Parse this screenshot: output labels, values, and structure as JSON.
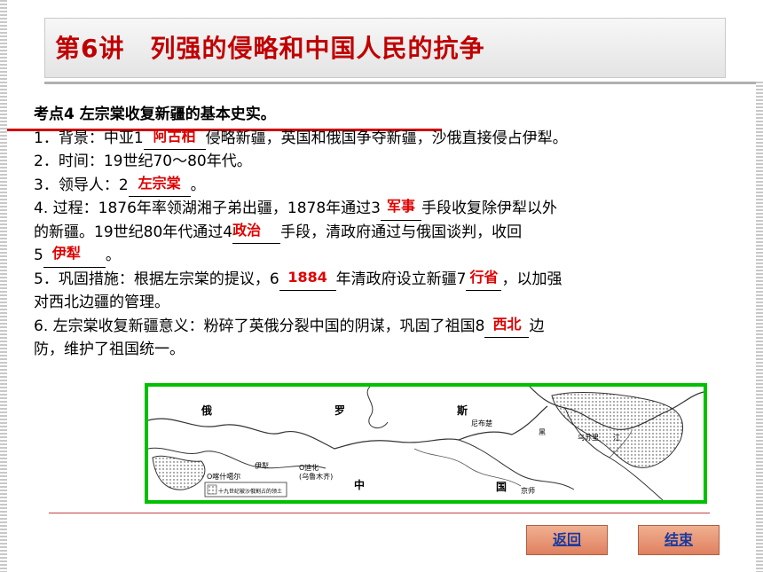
{
  "title": "第6讲　列强的侵略和中国人民的抗争",
  "section": {
    "heading": "考点4  左宗棠收复新疆的基本史实。",
    "item1": {
      "prefix": "1．背景：中亚1",
      "answer": "阿古柏",
      "suffix": "侵略新疆，英国和俄国争夺新疆，沙俄直接侵占伊犁。"
    },
    "item2": "2．时间：19世纪70～80年代。",
    "item3": {
      "prefix": "3．领导人：2",
      "answer": "左宗棠",
      "suffix": "。"
    },
    "item4": {
      "prefix": "4. 过程：1876年率领湖湘子弟出疆，1878年通过3",
      "answer1": "军事",
      "mid1": "手段收复除伊犁以外",
      "line2_prefix": "的新疆。19世纪80年代通过4",
      "answer2": "政治",
      "mid2": "手段，清政府通过与俄国谈判，收回",
      "line3_prefix": "5",
      "answer3": "伊犁",
      "line3_suffix": "。"
    },
    "item5": {
      "prefix": "5．巩固措施：根据左宗棠的提议，6",
      "answer1": "1884",
      "mid": "年清政府设立新疆7",
      "answer2": "行省",
      "suffix": "，以加强",
      "line2": "对西北边疆的管理。"
    },
    "item6": {
      "prefix": "6. 左宗棠收复新疆意义：粉碎了英俄分裂中国的阴谋，巩固了祖国8",
      "answer": "西北",
      "suffix": "边",
      "line2": "防，维护了祖国统一。"
    }
  },
  "map": {
    "labels": {
      "e": "俄",
      "luo": "罗",
      "si": "斯",
      "zhong": "中",
      "guo": "国",
      "yili": "伊犁",
      "dihua": "O迪化",
      "wulumuqi": "(乌鲁木齐)",
      "kashi": "O喀什噶尔",
      "nibuchu": "尼布楚",
      "heilong": "黑",
      "wusuli": "乌苏里",
      "jiang": "江",
      "beijing": "京师",
      "legend": "十九世纪被沙俄割占的领土"
    }
  },
  "nav": {
    "back": "返回",
    "end": "结束"
  },
  "colors": {
    "title_red": "#c00000",
    "answer_red": "#e00000",
    "map_border": "#00c000",
    "button_bg": "#e08060",
    "button_text": "#1a3aa0"
  }
}
